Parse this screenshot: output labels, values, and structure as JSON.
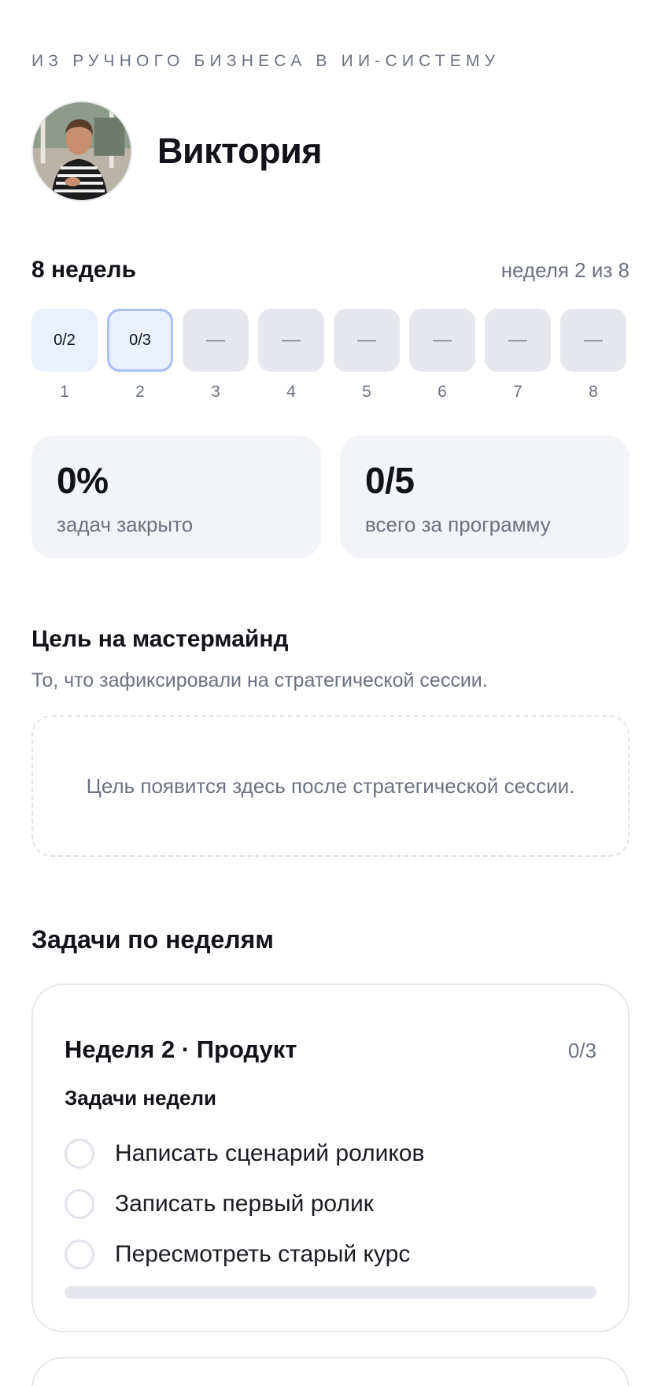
{
  "program": {
    "eyebrow": "ИЗ РУЧНОГО БИЗНЕСА В ИИ-СИСТЕМУ"
  },
  "profile": {
    "name": "Виктория"
  },
  "weeks": {
    "title": "8 недель",
    "meta": "неделя 2 из 8",
    "items": [
      {
        "num": "1",
        "value": "0/2",
        "state": "started"
      },
      {
        "num": "2",
        "value": "0/3",
        "state": "current"
      },
      {
        "num": "3",
        "value": "—",
        "state": "empty"
      },
      {
        "num": "4",
        "value": "—",
        "state": "empty"
      },
      {
        "num": "5",
        "value": "—",
        "state": "empty"
      },
      {
        "num": "6",
        "value": "—",
        "state": "empty"
      },
      {
        "num": "7",
        "value": "—",
        "state": "empty"
      },
      {
        "num": "8",
        "value": "—",
        "state": "empty"
      }
    ]
  },
  "stats": [
    {
      "value": "0%",
      "label": "задач закрыто"
    },
    {
      "value": "0/5",
      "label": "всего за программу"
    }
  ],
  "goal": {
    "title": "Цель на мастермайнд",
    "subtitle": "То, что зафиксировали на стратегической сессии.",
    "placeholder": "Цель появится здесь после стратегической сессии."
  },
  "tasks": {
    "title": "Задачи по неделям",
    "week_card": {
      "title": "Неделя 2 · Продукт",
      "count": "0/3",
      "subtitle": "Задачи недели",
      "items": [
        {
          "text": "Написать сценарий роликов",
          "done": false
        },
        {
          "text": "Записать первый ролик",
          "done": false
        },
        {
          "text": "Пересмотреть старый курс",
          "done": false
        }
      ],
      "progress": 0
    }
  },
  "colors": {
    "accent": "#3b6fe6",
    "current_week_border": "#a9c1f7",
    "started_week_bg": "#eaf0fe"
  }
}
